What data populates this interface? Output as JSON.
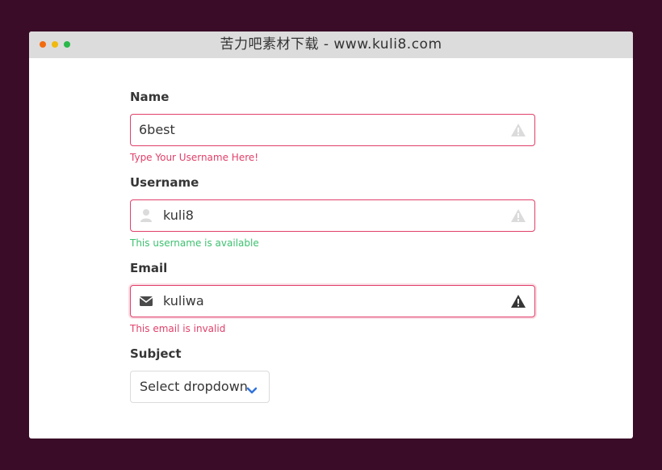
{
  "window": {
    "title": "苦力吧素材下载 - www.kuli8.com"
  },
  "form": {
    "name": {
      "label": "Name",
      "value": "6best",
      "help": "Type Your Username Here!",
      "right_icon": "warning-icon"
    },
    "username": {
      "label": "Username",
      "value": "kuli8",
      "help": "This username is available",
      "left_icon": "user-icon",
      "right_icon": "warning-icon"
    },
    "email": {
      "label": "Email",
      "value": "kuliwa",
      "help": "This email is invalid",
      "left_icon": "envelope-icon",
      "right_icon": "warning-icon"
    },
    "subject": {
      "label": "Subject",
      "selected": "Select dropdown",
      "icon": "chevron-down-icon"
    }
  },
  "colors": {
    "background": "#3a0c27",
    "danger": "#e1406a",
    "success": "#3ec170",
    "accent": "#3273dc"
  }
}
